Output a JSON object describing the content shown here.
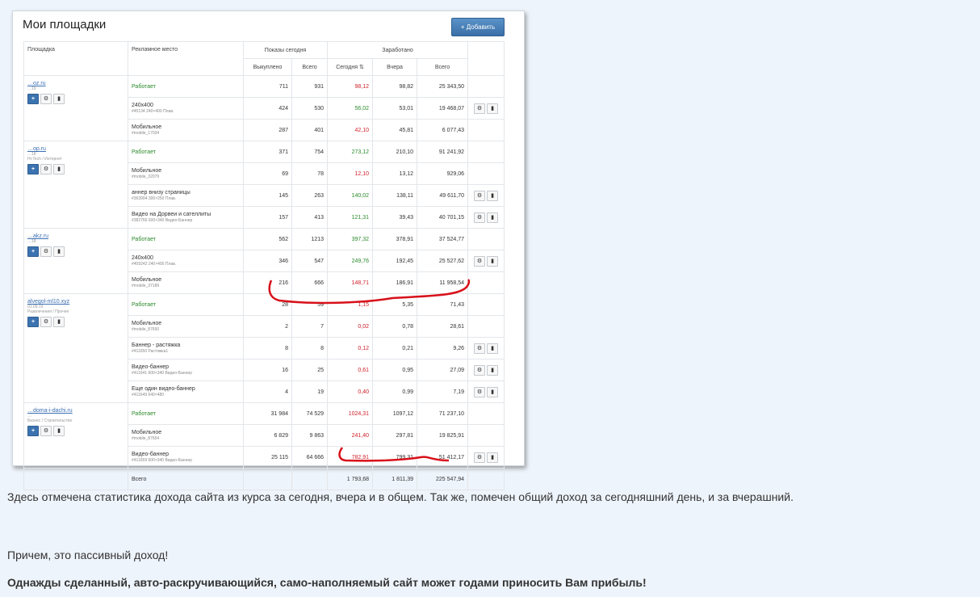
{
  "panel": {
    "title": "Мои площадки",
    "add_button": "+ Добавить",
    "headers": {
      "site": "Площадка",
      "ad_place": "Рекламное место",
      "shows_today": "Показы сегодня",
      "earned": "Заработано",
      "bought": "Выкуплено",
      "total": "Всего",
      "today": "Сегодня ⇅",
      "yesterday": "Вчера",
      "all": "Всего"
    },
    "sites": [
      {
        "link": "…oz.ru",
        "date": "…19",
        "category": "",
        "rows": [
          {
            "place": "Работает",
            "status": true,
            "sub": "",
            "bought": "711",
            "total": "931",
            "today": "98,12",
            "today_c": "red",
            "yesterday": "98,82",
            "all": "25 343,50",
            "actions": false
          },
          {
            "place": "240x400",
            "status": false,
            "sub": "#45134 240×400 Плав.",
            "bought": "424",
            "total": "530",
            "today": "56,02",
            "today_c": "green",
            "yesterday": "53,01",
            "all": "19 468,07",
            "actions": true
          },
          {
            "place": "Мобильное",
            "status": false,
            "sub": "#mobile_17034",
            "bought": "287",
            "total": "401",
            "today": "42,10",
            "today_c": "red",
            "yesterday": "45,81",
            "all": "6 077,43",
            "actions": false
          }
        ]
      },
      {
        "link": "…op.ru",
        "date": "…18",
        "category": "Hi-Tech / Интернет",
        "rows": [
          {
            "place": "Работает",
            "status": true,
            "sub": "",
            "bought": "371",
            "total": "754",
            "today": "273,12",
            "today_c": "green",
            "yesterday": "210,10",
            "all": "91 241,92",
            "actions": false
          },
          {
            "place": "Мобильное",
            "status": false,
            "sub": "#mobile_32079",
            "bought": "69",
            "total": "78",
            "today": "12,10",
            "today_c": "red",
            "yesterday": "13,12",
            "all": "929,06",
            "actions": false
          },
          {
            "place": "аннер внизу страницы",
            "status": false,
            "sub": "#363904 300×250 Плав.",
            "bought": "145",
            "total": "263",
            "today": "140,02",
            "today_c": "green",
            "yesterday": "138,11",
            "all": "49 611,70",
            "actions": true
          },
          {
            "place": "Видео на Дорвеи и сателлиты",
            "status": false,
            "sub": "#382766 600×340 Видео-Баннер",
            "bought": "157",
            "total": "413",
            "today": "121,31",
            "today_c": "green",
            "yesterday": "39,43",
            "all": "40 701,15",
            "actions": true
          }
        ]
      },
      {
        "link": "…akz.ru",
        "date": "…18",
        "category": "",
        "rows": [
          {
            "place": "Работает",
            "status": true,
            "sub": "",
            "bought": "562",
            "total": "1213",
            "today": "397,32",
            "today_c": "green",
            "yesterday": "378,91",
            "all": "37 524,77",
            "actions": false
          },
          {
            "place": "240x400",
            "status": false,
            "sub": "#409242 240×400 Плав.",
            "bought": "346",
            "total": "547",
            "today": "249,76",
            "today_c": "green",
            "yesterday": "192,45",
            "all": "25 527,62",
            "actions": true
          },
          {
            "place": "Мобильное",
            "status": false,
            "sub": "#mobile_37189",
            "bought": "216",
            "total": "666",
            "today": "148,71",
            "today_c": "red",
            "yesterday": "186,91",
            "all": "11 958,54",
            "actions": false
          }
        ]
      },
      {
        "link": "alvegol-ml10.xyz",
        "date": "01.09.19",
        "category": "Развлечения / Прочее",
        "rows": [
          {
            "place": "Работает",
            "status": true,
            "sub": "",
            "bought": "28",
            "total": "59",
            "today": "1,15",
            "today_c": "red",
            "yesterday": "5,35",
            "all": "71,43",
            "actions": false
          },
          {
            "place": "Мобильное",
            "status": false,
            "sub": "#mobile_87650",
            "bought": "2",
            "total": "7",
            "today": "0,02",
            "today_c": "red",
            "yesterday": "0,78",
            "all": "28,61",
            "actions": false
          },
          {
            "place": "Баннер - растяжка",
            "status": false,
            "sub": "#411650 Растяжка1",
            "bought": "8",
            "total": "8",
            "today": "0,12",
            "today_c": "red",
            "yesterday": "0,21",
            "all": "9,26",
            "actions": true
          },
          {
            "place": "Видео-баннер",
            "status": false,
            "sub": "#411641 600×340 Видео-Баннер",
            "bought": "16",
            "total": "25",
            "today": "0,61",
            "today_c": "red",
            "yesterday": "0,95",
            "all": "27,09",
            "actions": true
          },
          {
            "place": "Еще один видео-баннер",
            "status": false,
            "sub": "#411649 640×480",
            "bought": "4",
            "total": "19",
            "today": "0,40",
            "today_c": "red",
            "yesterday": "0,99",
            "all": "7,19",
            "actions": true
          }
        ]
      },
      {
        "link": "…doma-i-dachi.ru",
        "date": "…",
        "category": "Бизнес / Строительство",
        "rows": [
          {
            "place": "Работает",
            "status": true,
            "sub": "",
            "bought": "31 984",
            "total": "74 529",
            "today": "1024,31",
            "today_c": "red",
            "yesterday": "1097,12",
            "all": "71 237,10",
            "actions": false
          },
          {
            "place": "Мобильное",
            "status": false,
            "sub": "#mobile_87654",
            "bought": "6 829",
            "total": "9 863",
            "today": "241,40",
            "today_c": "red",
            "yesterday": "297,81",
            "all": "19 825,91",
            "actions": false
          },
          {
            "place": "Видео-баннер",
            "status": false,
            "sub": "#411659 600×340 Видео-Баннер",
            "bought": "25 115",
            "total": "64 666",
            "today": "782,91",
            "today_c": "red",
            "yesterday": "799,31",
            "all": "51 412,17",
            "actions": true
          }
        ]
      }
    ],
    "totals": {
      "label": "Всего",
      "today": "1 793,68",
      "yesterday": "1 811,39",
      "all": "225 547,94"
    }
  },
  "text": {
    "p1": "Здесь отмечена статистика дохода сайта из курса за сегодня, вчера и в общем. Так же, помечен общий доход за сегодняшний день, и за вчерашний.",
    "p2": "Причем, это пассивный доход!",
    "p3": "Однажды сделанный, авто-раскручивающийся, само-наполняемый сайт может годами приносить Вам прибыль!"
  },
  "colors": {
    "accent": "#3b73b0",
    "positive": "#2a8a2a",
    "negative": "#d0202a",
    "highlight": "#d8101a"
  }
}
